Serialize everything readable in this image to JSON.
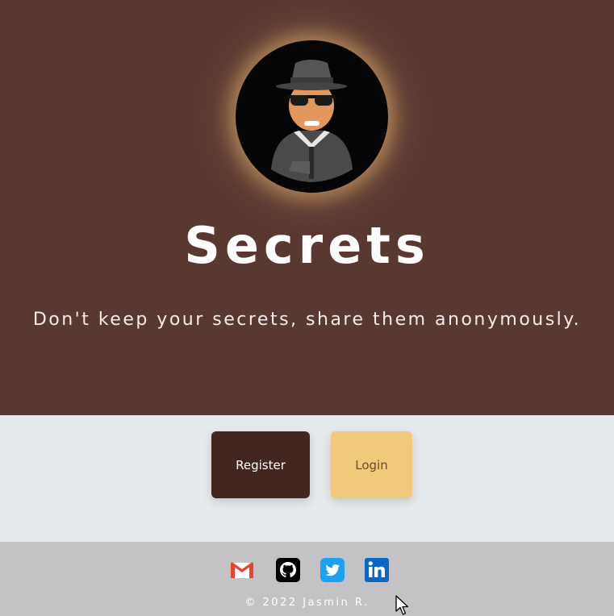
{
  "hero": {
    "title": "Secrets",
    "subtitle": "Don't keep your secrets, share them anonymously.",
    "avatar_icon": "spy-detective-icon"
  },
  "actions": {
    "register_label": "Register",
    "login_label": "Login"
  },
  "footer": {
    "social_icons": [
      "gmail-icon",
      "github-icon",
      "twitter-icon",
      "linkedin-icon"
    ],
    "copyright": "© 2022 Jasmin R."
  },
  "colors": {
    "hero_bg": "#5a3832",
    "actions_bg": "#e7eaed",
    "register_bg": "#442621",
    "login_bg": "#f1c97a",
    "footer_bg": "#c3c3c5"
  }
}
